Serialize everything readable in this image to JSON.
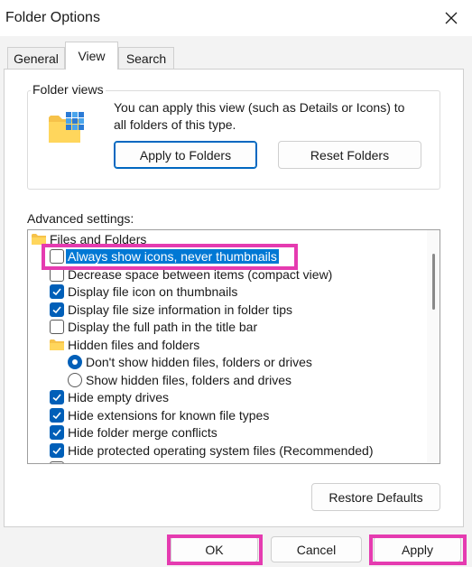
{
  "window": {
    "title": "Folder Options"
  },
  "tabs": [
    {
      "label": "General",
      "active": false
    },
    {
      "label": "View",
      "active": true
    },
    {
      "label": "Search",
      "active": false
    }
  ],
  "folder_views": {
    "group_label": "Folder views",
    "description_line1": "You can apply this view (such as Details or Icons) to",
    "description_line2": "all folders of this type.",
    "apply_button": "Apply to Folders",
    "reset_button": "Reset Folders"
  },
  "advanced": {
    "label": "Advanced settings:",
    "items": [
      {
        "type": "folder",
        "label": "Files and Folders"
      },
      {
        "type": "checkbox",
        "label": "Always show icons, never thumbnails",
        "checked": false,
        "selected": true
      },
      {
        "type": "checkbox",
        "label": "Decrease space between items (compact view)",
        "checked": false
      },
      {
        "type": "checkbox",
        "label": "Display file icon on thumbnails",
        "checked": true
      },
      {
        "type": "checkbox",
        "label": "Display file size information in folder tips",
        "checked": true
      },
      {
        "type": "checkbox",
        "label": "Display the full path in the title bar",
        "checked": false
      },
      {
        "type": "folder",
        "label": "Hidden files and folders"
      },
      {
        "type": "radio",
        "label": "Don't show hidden files, folders or drives",
        "checked": true
      },
      {
        "type": "radio",
        "label": "Show hidden files, folders and drives",
        "checked": false
      },
      {
        "type": "checkbox",
        "label": "Hide empty drives",
        "checked": true
      },
      {
        "type": "checkbox",
        "label": "Hide extensions for known file types",
        "checked": true
      },
      {
        "type": "checkbox",
        "label": "Hide folder merge conflicts",
        "checked": true
      },
      {
        "type": "checkbox",
        "label": "Hide protected operating system files (Recommended)",
        "checked": true
      }
    ],
    "restore_button": "Restore Defaults"
  },
  "footer": {
    "ok": "OK",
    "cancel": "Cancel",
    "apply": "Apply"
  },
  "colors": {
    "accent": "#005fb8",
    "highlight": "#e53bb0",
    "selection": "#0078d4"
  }
}
